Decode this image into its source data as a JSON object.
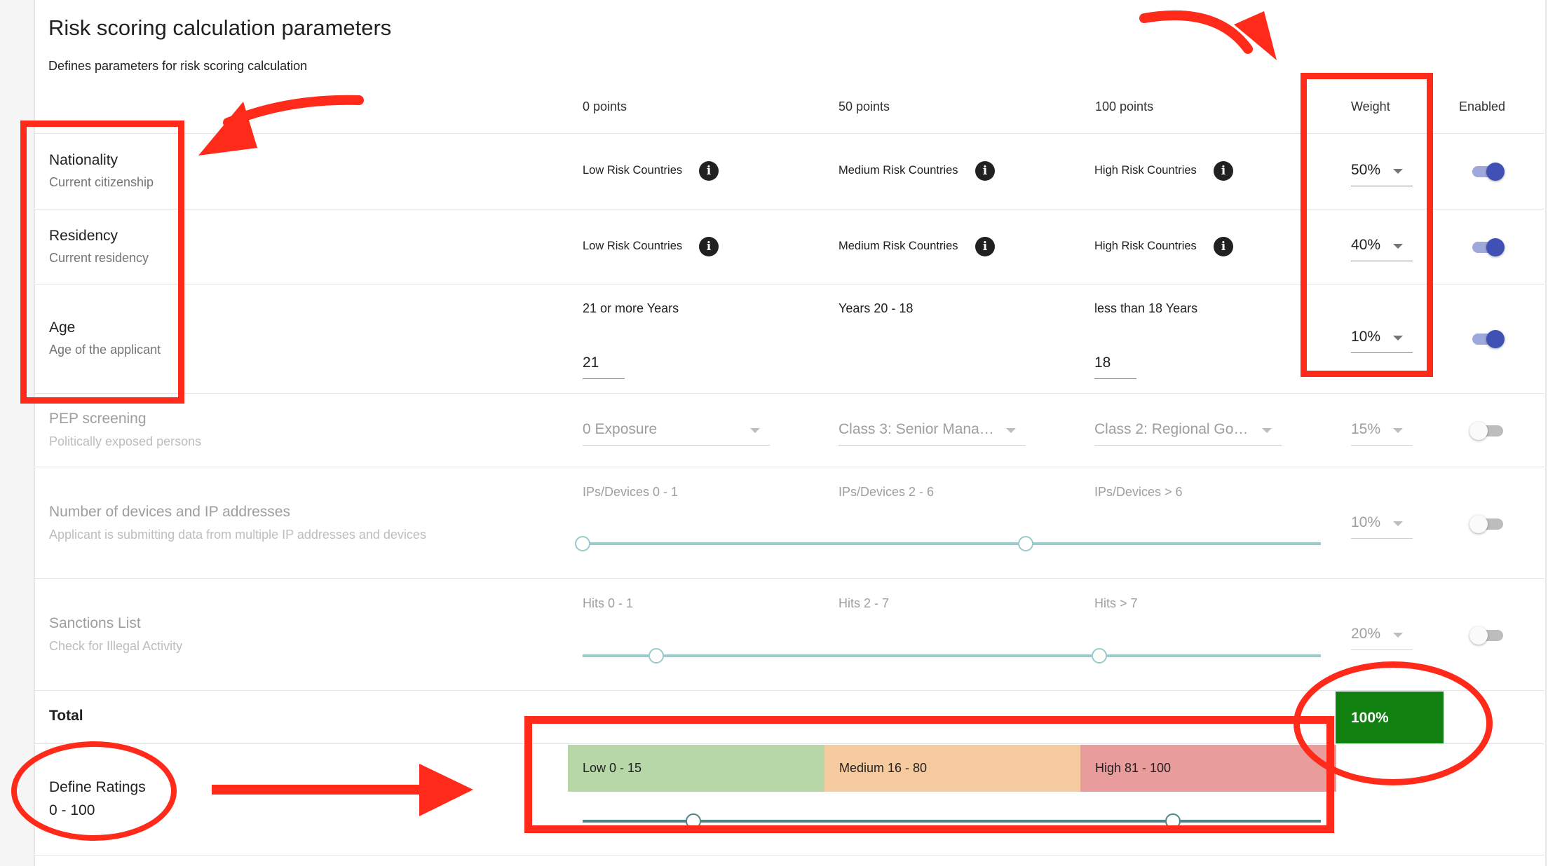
{
  "page": {
    "title": "Risk scoring calculation parameters",
    "subtitle": "Defines parameters for risk scoring calculation"
  },
  "columns": {
    "c0": "0 points",
    "c50": "50 points",
    "c100": "100 points",
    "weight": "Weight",
    "enabled": "Enabled"
  },
  "rows": {
    "nationality": {
      "name": "Nationality",
      "desc": "Current citizenship",
      "low": "Low Risk Countries",
      "medium": "Medium Risk Countries",
      "high": "High Risk Countries",
      "weight": "50%",
      "enabled": true
    },
    "residency": {
      "name": "Residency",
      "desc": "Current residency",
      "low": "Low Risk Countries",
      "medium": "Medium Risk Countries",
      "high": "High Risk Countries",
      "weight": "40%",
      "enabled": true
    },
    "age": {
      "name": "Age",
      "desc": "Age of the applicant",
      "low": "21 or more Years",
      "medium": "Years 20 - 18",
      "high": "less than 18 Years",
      "low_value": "21",
      "high_value": "18",
      "weight": "10%",
      "enabled": true
    },
    "pep": {
      "name": "PEP screening",
      "desc": "Politically exposed persons",
      "low": "0 Exposure",
      "medium": "Class 3: Senior Mana…",
      "high": "Class 2: Regional Go…",
      "weight": "15%",
      "enabled": false
    },
    "devices": {
      "name": "Number of devices and IP addresses",
      "desc": "Applicant is submitting data from multiple IP addresses and devices",
      "low": "IPs/Devices 0 - 1",
      "medium": "IPs/Devices 2 - 6",
      "high": "IPs/Devices > 6",
      "slider_min": 0,
      "slider_max": 10,
      "slider_values": [
        0,
        6
      ],
      "weight": "10%",
      "enabled": false
    },
    "sanctions": {
      "name": "Sanctions List",
      "desc": "Check for Illegal Activity",
      "low": "Hits 0 - 1",
      "medium": "Hits 2 - 7",
      "high": "Hits > 7",
      "slider_min": 0,
      "slider_max": 10,
      "slider_values": [
        1,
        7
      ],
      "weight": "20%",
      "enabled": false
    }
  },
  "total": {
    "label": "Total",
    "value": "100%",
    "color": "#108010"
  },
  "ratings": {
    "name": "Define Ratings",
    "range": "0 - 100",
    "low": "Low 0 - 15",
    "medium": "Medium 16 - 80",
    "high": "High 81 - 100",
    "low_color": "#b7d7a8",
    "medium_color": "#f6ca9f",
    "high_color": "#e89c9c",
    "thresholds": [
      15,
      80
    ]
  },
  "annotations": {
    "color": "#ff2a1a"
  }
}
